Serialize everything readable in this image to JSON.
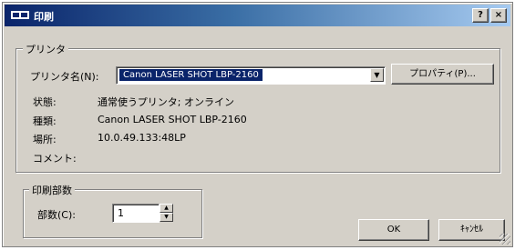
{
  "window": {
    "title": "印刷",
    "help_button": "?",
    "close_button": "×"
  },
  "printer_group": {
    "label": "プリンタ",
    "printer_name_label": "プリンタ名(N):",
    "printer_name_value": "Canon LASER SHOT LBP-2160",
    "properties_button": "プロパティ(P)...",
    "status_label": "状態:",
    "status_value": "通常使うプリンタ; オンライン",
    "type_label": "種類:",
    "type_value": "Canon LASER SHOT LBP-2160",
    "where_label": "場所:",
    "where_value": "10.0.49.133:48LP",
    "comment_label": "コメント:",
    "comment_value": ""
  },
  "copies_group": {
    "label": "印刷部数",
    "copies_label": "部数(C):",
    "copies_value": "1"
  },
  "buttons": {
    "ok": "OK",
    "cancel": "ｷｬﾝｾﾙ"
  },
  "icons": {
    "dropdown": "chevron-down-icon",
    "spin_up": "spin-up-icon",
    "spin_down": "spin-down-icon",
    "title": "printer-icon"
  },
  "colors": {
    "titlebar_start": "#0a246a",
    "titlebar_end": "#a6caf0",
    "face": "#d4d0c8",
    "selection": "#0a246a"
  }
}
